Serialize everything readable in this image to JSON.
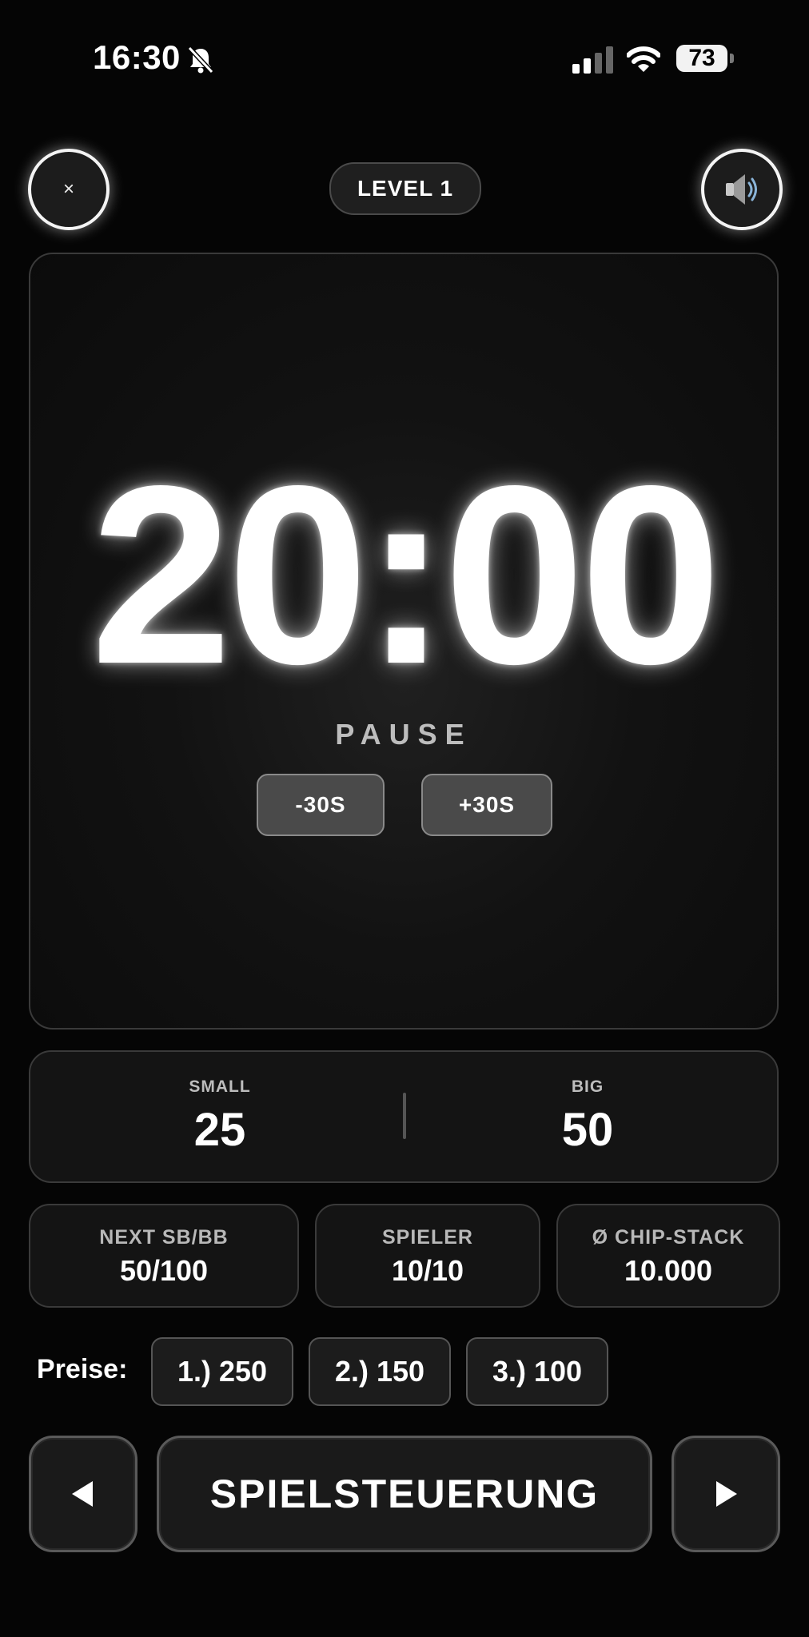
{
  "status_bar": {
    "time": "16:30",
    "battery_percent": "73",
    "icons": [
      "bell-muted-icon",
      "cellular-signal-icon",
      "wifi-icon",
      "battery-icon"
    ]
  },
  "header": {
    "close_label": "×",
    "level_label": "LEVEL 1",
    "sound_icon": "speaker-icon"
  },
  "timer": {
    "time": "20:00",
    "state_label": "PAUSE",
    "minus_label": "-30S",
    "plus_label": "+30S"
  },
  "blinds": {
    "small_label": "SMALL",
    "small_value": "25",
    "big_label": "BIG",
    "big_value": "50"
  },
  "stats": [
    {
      "label": "NEXT SB/BB",
      "value": "50/100"
    },
    {
      "label": "SPIELER",
      "value": "10/10"
    },
    {
      "label": "Ø CHIP-STACK",
      "value": "10.000"
    }
  ],
  "prizes": {
    "title": "Preise:",
    "items": [
      "1.) 250",
      "2.) 150",
      "3.) 100"
    ]
  },
  "controls": {
    "prev_icon": "triangle-left-icon",
    "main_label": "SPIELSTEUERUNG",
    "next_icon": "triangle-right-icon"
  },
  "colors": {
    "background": "#050505",
    "panel": "#141414",
    "border": "#3a3a3a",
    "text": "#ffffff",
    "muted_text": "#bdbdbd"
  }
}
